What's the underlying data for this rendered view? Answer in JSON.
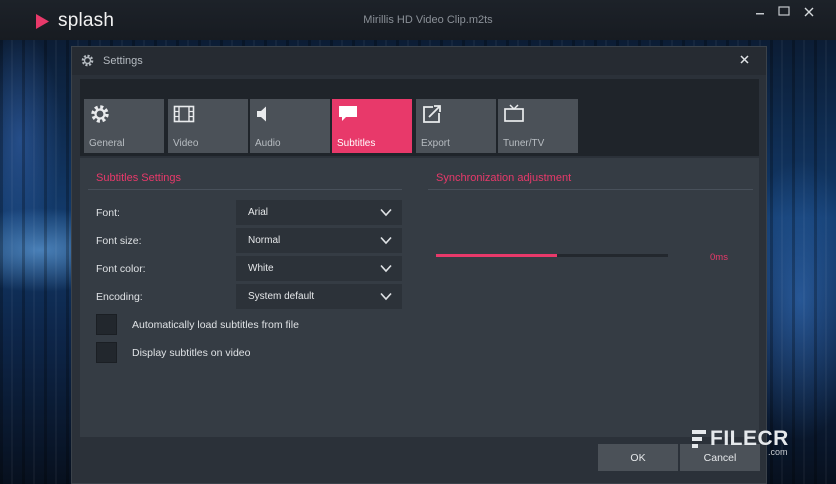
{
  "app": {
    "brand": "splash",
    "file_title": "Mirillis HD Video Clip.m2ts",
    "accent": "#e8396a"
  },
  "dialog": {
    "title": "Settings",
    "tabs": [
      {
        "label": "General",
        "icon": "gear-icon"
      },
      {
        "label": "Video",
        "icon": "film-icon"
      },
      {
        "label": "Audio",
        "icon": "speaker-icon"
      },
      {
        "label": "Subtitles",
        "icon": "speech-bubble-icon",
        "active": true
      },
      {
        "label": "Export",
        "icon": "export-icon"
      },
      {
        "label": "Tuner/TV",
        "icon": "tv-icon"
      }
    ],
    "subtitles_settings": {
      "title": "Subtitles Settings",
      "font_label": "Font:",
      "font_value": "Arial",
      "font_size_label": "Font size:",
      "font_size_value": "Normal",
      "font_color_label": "Font color:",
      "font_color_value": "White",
      "encoding_label": "Encoding:",
      "encoding_value": "System default",
      "auto_load_label": "Automatically load subtitles from file",
      "display_label": "Display subtitles on video"
    },
    "sync": {
      "title": "Synchronization adjustment",
      "value": "0ms",
      "slider_fraction": 0.52
    },
    "ok_label": "OK",
    "cancel_label": "Cancel"
  },
  "watermark": {
    "text": "FILECR",
    "sub": ".com"
  }
}
